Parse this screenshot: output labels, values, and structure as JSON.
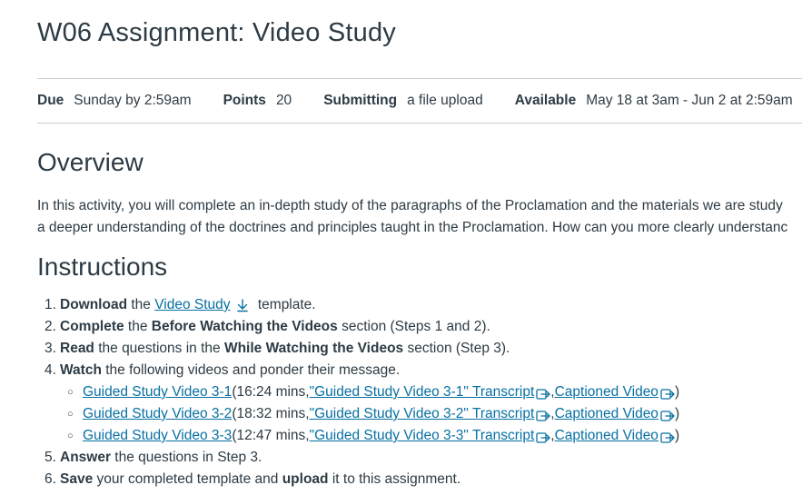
{
  "page": {
    "title": "W06 Assignment: Video Study"
  },
  "meta": {
    "due_label": "Due",
    "due_value": "Sunday by 2:59am",
    "points_label": "Points",
    "points_value": "20",
    "submitting_label": "Submitting",
    "submitting_value": "a file upload",
    "available_label": "Available",
    "available_value": "May 18 at 3am - Jun 2 at 2:59am"
  },
  "overview": {
    "heading": "Overview",
    "line1": "In this activity, you will complete an in-depth study of the paragraphs of the Proclamation and the materials we are study",
    "line2": "a deeper understanding of the doctrines and principles taught in the Proclamation. How can you more clearly understanc"
  },
  "instructions": {
    "heading": "Instructions",
    "steps": [
      {
        "num": "1.",
        "bold": "Download",
        "text_a": " the ",
        "link": "Video Study",
        "text_b": " template."
      },
      {
        "num": "2.",
        "bold": "Complete",
        "text_a": " the ",
        "bold2": "Before Watching the Videos",
        "text_b": " section (Steps 1 and 2)."
      },
      {
        "num": "3.",
        "bold": "Read",
        "text_a": " the questions in the ",
        "bold2": "While Watching the Videos",
        "text_b": " section (Step 3)."
      },
      {
        "num": "4.",
        "bold": "Watch",
        "text_a": " the following videos and ponder their message."
      },
      {
        "num": "5.",
        "bold": "Answer",
        "text_a": " the questions in Step 3."
      },
      {
        "num": "6.",
        "bold": "Save",
        "text_a": " your completed template and ",
        "bold2": "upload",
        "text_b": " it to this assignment."
      }
    ],
    "videos": [
      {
        "link": "Guided Study Video 3-1",
        "duration": " (16:24 mins, ",
        "transcript": "\"Guided Study Video 3-1\" Transcript",
        "sep": ", ",
        "captioned": "Captioned Video",
        "close": ")"
      },
      {
        "link": "Guided Study Video 3-2",
        "duration": " (18:32 mins, ",
        "transcript": "\"Guided Study Video 3-2\" Transcript",
        "sep": ", ",
        "captioned": "Captioned Video",
        "close": ")"
      },
      {
        "link": "Guided Study Video 3-3",
        "duration": " (12:47 mins, ",
        "transcript": "\"Guided Study Video 3-3\" Transcript",
        "sep": ", ",
        "captioned": "Captioned Video",
        "close": ")"
      }
    ]
  },
  "icons": {
    "download": "download-icon",
    "external": "external-link-icon"
  },
  "colors": {
    "text": "#2d3b45",
    "link": "#0770a3",
    "divider": "#c7cdd1"
  }
}
